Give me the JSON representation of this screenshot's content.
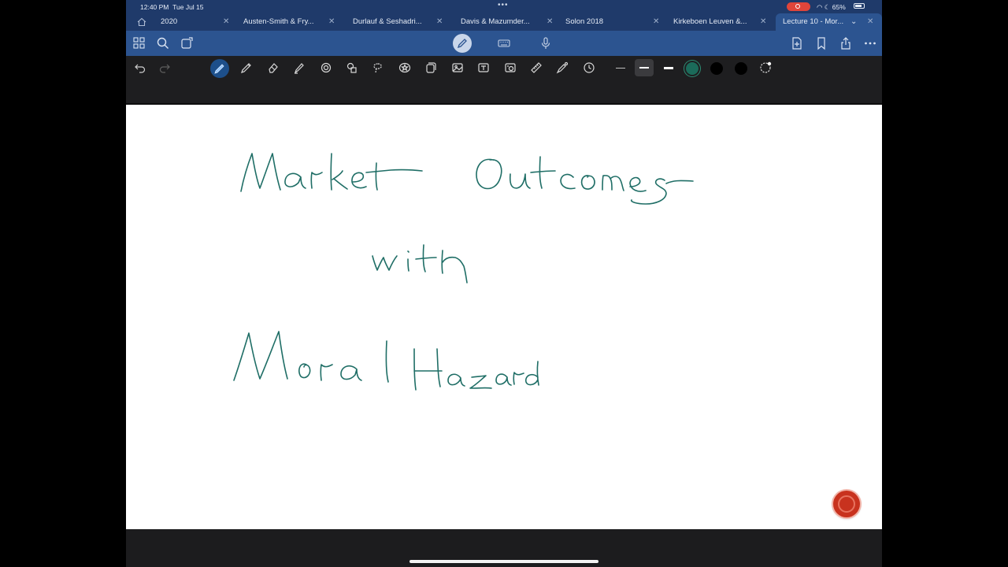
{
  "status_bar": {
    "time": "12:40 PM",
    "date": "Tue Jul 15",
    "battery": "65%"
  },
  "tabs": [
    {
      "label": "​2020"
    },
    {
      "label": "Austen-Smith & Fry..."
    },
    {
      "label": "Durlauf & Seshadri..."
    },
    {
      "label": "Davis & Mazumder..."
    },
    {
      "label": "Solon 2018"
    },
    {
      "label": "Kirkeboen Leuven &..."
    },
    {
      "label": "Lecture 10 - Mor...",
      "active": true
    }
  ],
  "toolbar": {
    "top_left_icons": [
      "grid-icon",
      "search-icon",
      "pages-icon"
    ],
    "mode_icons": [
      "pen-mode-icon",
      "keyboard-icon",
      "microphone-icon"
    ],
    "top_right_icons": [
      "add-page-icon",
      "bookmark-icon",
      "share-icon",
      "more-icon"
    ],
    "tools": [
      "undo-icon",
      "redo-icon",
      "pen-icon",
      "pencil-icon",
      "eraser-icon",
      "highlighter-icon",
      "shape-icon",
      "element-icon",
      "lasso-icon",
      "star-icon",
      "sticker-icon",
      "image-icon",
      "text-icon",
      "camera-icon",
      "ruler-icon",
      "laser-icon",
      "clock-icon"
    ],
    "stroke_widths": [
      "thin",
      "medium",
      "thick"
    ],
    "selected_stroke": "medium",
    "colors": [
      "#1b6b5a",
      "#000000",
      "#000000"
    ],
    "selected_color": "#1b6b5a"
  },
  "canvas": {
    "ink_color": "#1f6e66",
    "handwriting": [
      "Market Outcomes",
      "with",
      "Moral Hazard"
    ]
  }
}
